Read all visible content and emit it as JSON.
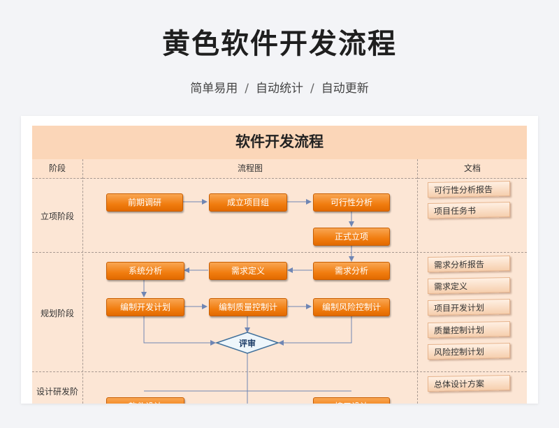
{
  "hero": {
    "title": "黄色软件开发流程",
    "sub1": "简单易用",
    "sub2": "自动统计",
    "sub3": "自动更新",
    "separator": "/"
  },
  "sheet": {
    "title": "软件开发流程",
    "col_stage": "阶段",
    "col_flow": "流程图",
    "col_docs": "文档"
  },
  "stages": {
    "initiation": "立项阶段",
    "planning": "规划阶段",
    "design": "设计研发阶"
  },
  "flow": {
    "prelim_research": "前期调研",
    "form_team": "成立项目组",
    "feasibility": "可行性分析",
    "formal_approval": "正式立项",
    "system_analysis": "系统分析",
    "req_definition": "需求定义",
    "req_analysis": "需求分析",
    "dev_plan": "编制开发计划",
    "quality_plan": "编制质量控制计",
    "risk_plan": "编制风险控制计",
    "review": "评审",
    "software_design": "软件设计",
    "interface_design": "接口设计"
  },
  "docs": {
    "feasibility_report": "可行性分析报告",
    "project_charter": "项目任务书",
    "req_analysis_report": "需求分析报告",
    "req_definition": "需求定义",
    "dev_plan": "项目开发计划",
    "quality_plan": "质量控制计划",
    "risk_plan": "风险控制计划",
    "overall_design": "总体设计方案"
  },
  "colors": {
    "box_orange": "#f17d10",
    "sheet_bg": "#fce6d5",
    "header_bg": "#fbd6b8",
    "arrow": "#6f86b4"
  }
}
